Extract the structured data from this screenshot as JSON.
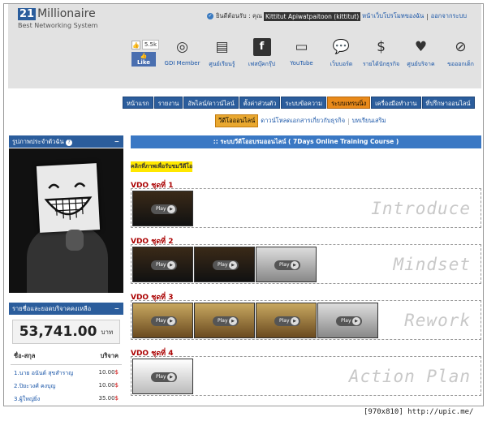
{
  "logo": {
    "num": "21",
    "name": "Millionaire",
    "sub": "Best Networking System"
  },
  "welcome": {
    "prefix": "ยินดีต้อนรับ : คุณ",
    "user": "Kittitut Apiwatpaitoon (kittitut)",
    "my_page": "หน้าเว็บโปรโมทของฉัน",
    "sep": "|",
    "logout": "ออกจากระบบ"
  },
  "like": {
    "count": "5.5k",
    "label": "Like"
  },
  "icons": [
    {
      "icon": "globe-icon",
      "glyph": "◎",
      "label": "GDI Member"
    },
    {
      "icon": "cabinet-icon",
      "glyph": "▤",
      "label": "ศูนย์เรียนรู้"
    },
    {
      "icon": "facebook-icon",
      "glyph": "f",
      "label": "เฟสบุ๊คกรุ๊ป"
    },
    {
      "icon": "youtube-icon",
      "glyph": "▭",
      "label": "YouTube"
    },
    {
      "icon": "chat-icon",
      "glyph": "💬",
      "label": "เว็บบอร์ด"
    },
    {
      "icon": "dollar-icon",
      "glyph": "$",
      "label": "รายได้นักธุรกิจ"
    },
    {
      "icon": "heart-icon",
      "glyph": "♥",
      "label": "ศูนย์บริจาค"
    },
    {
      "icon": "no-entry-icon",
      "glyph": "⊘",
      "label": "ขอออกเด็ก"
    }
  ],
  "nav": [
    "หน้าแรก",
    "รายงาน",
    "อัพไลน์/ดาวน์ไลน์",
    "ตั้งค่าส่วนตัว",
    "ระบบข้อความ",
    "ระบบเทรนนิ่ง",
    "เครื่องมือทำงาน",
    "ที่ปรึกษาออนไลน์"
  ],
  "nav_active": 5,
  "subnav": {
    "active": "วีดีโอออนไลน์",
    "link1": "ดาวน์โหลดเอกสารเกี่ยวกับธุรกิจ",
    "sep": "|",
    "link2": "บทเรียนเสริม"
  },
  "profile": {
    "title": "รูปภาพประจำตัวฉัน",
    "help": "?",
    "minimize": "−"
  },
  "donation": {
    "title": "รายชื่อและยอดบริจาคคงเหลือ",
    "minimize": "−",
    "balance": "53,741.00",
    "currency": "บาท",
    "col_name": "ชื่อ-สกุล",
    "col_amount": "บริจาค",
    "rows": [
      {
        "name": "1.นาย อนันต์ สุขสำราญ",
        "amount": "10.00",
        "cur": "$"
      },
      {
        "name": "2.ปิยะวงศ์ คงบุญ",
        "amount": "10.00",
        "cur": "$"
      },
      {
        "name": "3.ผู้ใหญ่ยิ่ง",
        "amount": "35.00",
        "cur": "$"
      }
    ]
  },
  "main": {
    "title": ":: ระบบวีดีโออบรมออนไลน์ ( 7Days Online Training Course )",
    "click_note": "คลิกที่ภาพเพื่อรับชมวีดีโอ",
    "play": "Play",
    "sets": [
      {
        "title": "VDO ชุดที่ 1",
        "label": "Introduce",
        "thumbs": [
          "d"
        ]
      },
      {
        "title": "VDO ชุดที่ 2",
        "label": "Mindset",
        "thumbs": [
          "d",
          "d",
          "l"
        ]
      },
      {
        "title": "VDO ชุดที่ 3",
        "label": "Rework",
        "thumbs": [
          "g",
          "g",
          "g",
          "l"
        ]
      },
      {
        "title": "VDO ชุดที่ 4",
        "label": "Action Plan",
        "thumbs": [
          "w"
        ]
      }
    ]
  },
  "footer": "[970x810] http://upic.me/"
}
